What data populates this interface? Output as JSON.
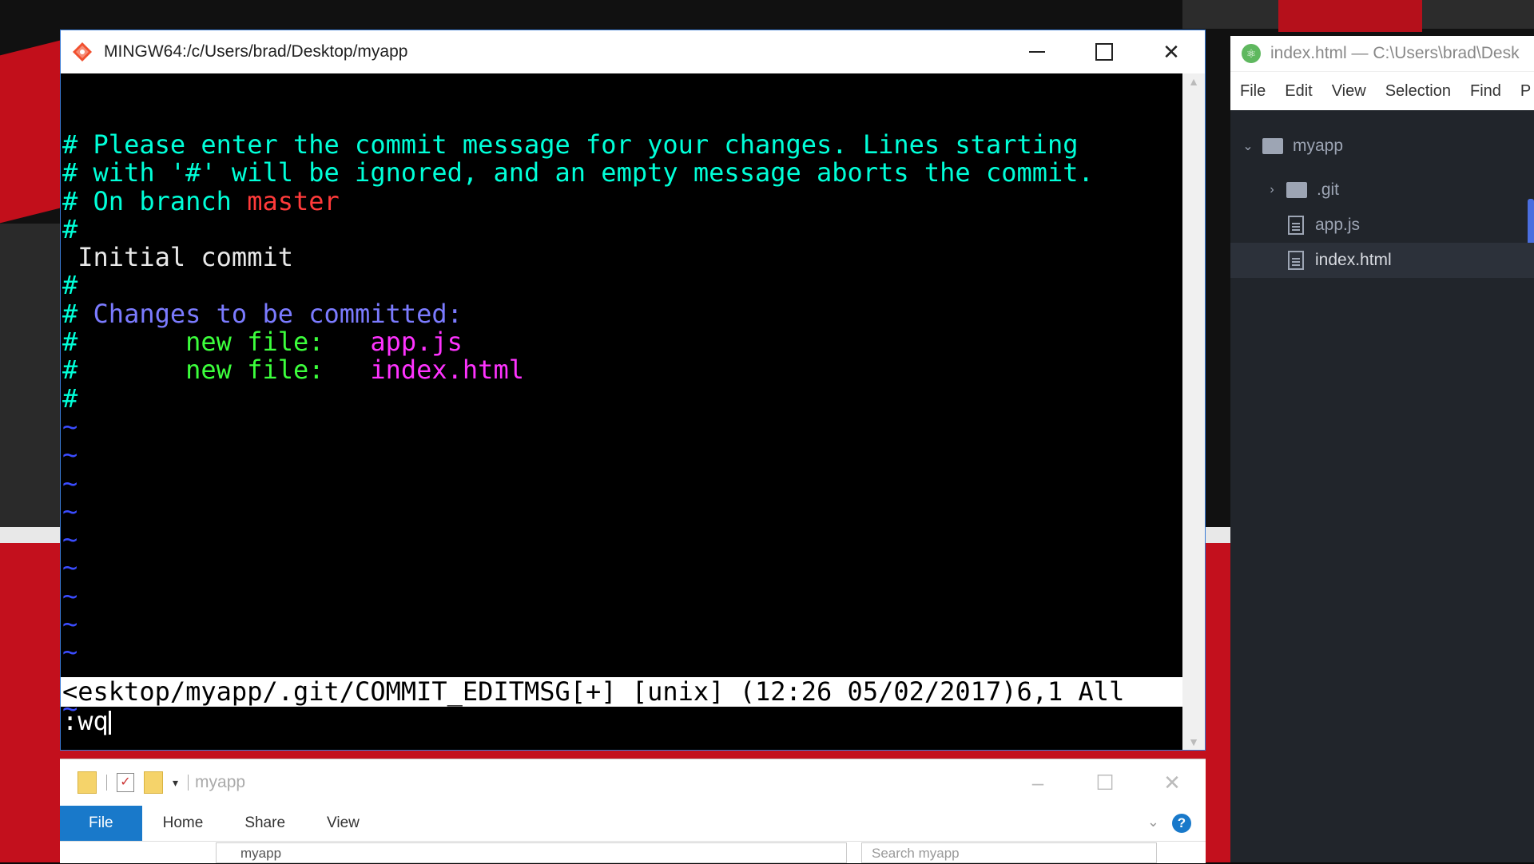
{
  "terminal": {
    "title": "MINGW64:/c/Users/brad/Desktop/myapp",
    "lines": [
      {
        "parts": [
          {
            "t": "# Please enter the commit message for your changes. Lines starting",
            "c": "cyan"
          }
        ]
      },
      {
        "parts": [
          {
            "t": "# with '#' will be ignored, and an empty message aborts the commit.",
            "c": "cyan"
          }
        ]
      },
      {
        "parts": [
          {
            "t": "# On branch ",
            "c": "cyan"
          },
          {
            "t": "master",
            "c": "red"
          }
        ]
      },
      {
        "parts": [
          {
            "t": "#",
            "c": "cyan"
          }
        ]
      },
      {
        "parts": [
          {
            "t": " Initial commit",
            "c": "white"
          }
        ]
      },
      {
        "parts": [
          {
            "t": "#",
            "c": "cyan"
          }
        ]
      },
      {
        "parts": [
          {
            "t": "# ",
            "c": "cyan"
          },
          {
            "t": "Changes to be committed:",
            "c": "blue"
          }
        ]
      },
      {
        "parts": [
          {
            "t": "#",
            "c": "cyan"
          },
          {
            "t": "       new file:   ",
            "c": "green"
          },
          {
            "t": "app.js",
            "c": "magenta"
          }
        ]
      },
      {
        "parts": [
          {
            "t": "#",
            "c": "cyan"
          },
          {
            "t": "       new file:   ",
            "c": "green"
          },
          {
            "t": "index.html",
            "c": "magenta"
          }
        ]
      },
      {
        "parts": [
          {
            "t": "#",
            "c": "cyan"
          }
        ]
      },
      {
        "parts": [
          {
            "t": "~",
            "c": "tilde"
          }
        ]
      },
      {
        "parts": [
          {
            "t": "~",
            "c": "tilde"
          }
        ]
      },
      {
        "parts": [
          {
            "t": "~",
            "c": "tilde"
          }
        ]
      },
      {
        "parts": [
          {
            "t": "~",
            "c": "tilde"
          }
        ]
      },
      {
        "parts": [
          {
            "t": "~",
            "c": "tilde"
          }
        ]
      },
      {
        "parts": [
          {
            "t": "~",
            "c": "tilde"
          }
        ]
      },
      {
        "parts": [
          {
            "t": "~",
            "c": "tilde"
          }
        ]
      },
      {
        "parts": [
          {
            "t": "~",
            "c": "tilde"
          }
        ]
      },
      {
        "parts": [
          {
            "t": "~",
            "c": "tilde"
          }
        ]
      },
      {
        "parts": [
          {
            "t": "~",
            "c": "tilde"
          }
        ]
      },
      {
        "parts": [
          {
            "t": "~",
            "c": "tilde"
          }
        ]
      }
    ],
    "statusline": "<esktop/myapp/.git/COMMIT_EDITMSG[+] [unix] (12:26 05/02/2017)6,1 All",
    "command": ":wq",
    "colors": {
      "cyan": "#00ffd8",
      "red": "#ff3a3a",
      "white": "#e8e8e8",
      "blue": "#7b7bff",
      "green": "#3cff3c",
      "magenta": "#ff33ff",
      "tilde": "#3a4cff"
    }
  },
  "explorer": {
    "title": "myapp",
    "tabs": [
      "File",
      "Home",
      "Share",
      "View"
    ],
    "address": "myapp",
    "search_placeholder": "Search myapp"
  },
  "editor": {
    "title": "index.html — C:\\Users\\brad\\Desk",
    "menu": [
      "File",
      "Edit",
      "View",
      "Selection",
      "Find",
      "P"
    ],
    "tree": [
      {
        "label": "myapp",
        "kind": "folder",
        "open": true,
        "depth": 0
      },
      {
        "label": ".git",
        "kind": "folder",
        "open": false,
        "depth": 1
      },
      {
        "label": "app.js",
        "kind": "file",
        "depth": 2
      },
      {
        "label": "index.html",
        "kind": "file",
        "depth": 2,
        "selected": true
      }
    ]
  }
}
